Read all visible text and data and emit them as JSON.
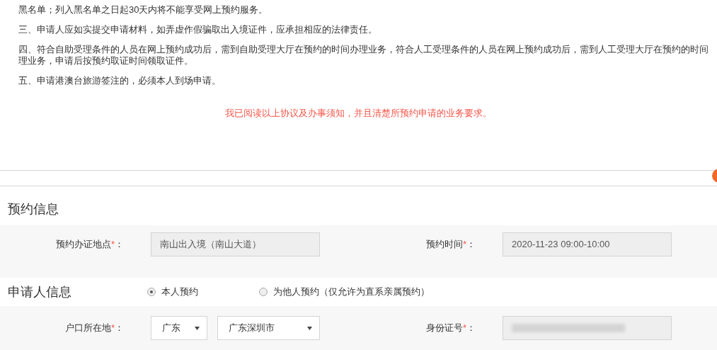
{
  "notice_lines": [
    "黑名单；列入黑名单之日起30天内将不能享受网上预约服务。",
    "三、申请人应如实提交申请材料，如弄虚作假骗取出入境证件，应承担相应的法律责任。",
    "四、符合自助受理条件的人员在网上预约成功后，需到自助受理大厅在预约的时间办理业务，符合人工受理条件的人员在网上预约成功后，需到人工受理大厅在预约的时间",
    "理业务，申请后按预约取证时间领取证件。",
    "五、申请港澳台旅游签注的，必须本人到场申请。"
  ],
  "agreement": "我已阅读以上协议及办事须知，并且清楚所预约申请的业务要求。",
  "label_colon": "：",
  "booking": {
    "title": "预约信息",
    "fields": [
      {
        "label": "预约办证地点",
        "required": "*",
        "value": "南山出入境（南山大道）"
      },
      {
        "label": "预约时间",
        "required": "*",
        "value": "2020-11-23 09:00-10:00"
      }
    ]
  },
  "applicant": {
    "title": "申请人信息",
    "options": [
      {
        "label": "本人预约",
        "selected": true
      },
      {
        "label": "为他人预约（仅允许为直系亲属预约）",
        "selected": false
      }
    ],
    "residence": {
      "label": "户口所在地",
      "required": "*",
      "province": "广东",
      "city": "广东深圳市"
    },
    "id_number": {
      "label": "身份证号",
      "required": "*"
    }
  }
}
